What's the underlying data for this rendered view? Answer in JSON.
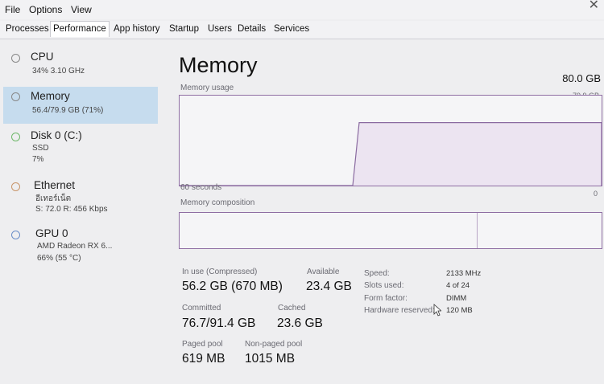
{
  "menu": [
    "File",
    "Options",
    "View"
  ],
  "tabs": [
    "Processes",
    "Performance",
    "App history",
    "Startup",
    "Users",
    "Details",
    "Services"
  ],
  "sidebar": [
    {
      "title": "CPU",
      "sub1": "34%  3.10 GHz",
      "sub2": "",
      "sub3": ""
    },
    {
      "title": "Memory",
      "sub1": "56.4/79.9 GB (71%)",
      "sub2": "",
      "sub3": ""
    },
    {
      "title": "Disk 0 (C:)",
      "sub1": "SSD",
      "sub2": "7%",
      "sub3": ""
    },
    {
      "title": "Ethernet",
      "sub1": "อีเทอร์เน็ต",
      "sub2": "S: 72.0  R: 456 Kbps",
      "sub3": ""
    },
    {
      "title": "GPU 0",
      "sub1": "AMD Radeon RX 6...",
      "sub2": "66% (55 °C)",
      "sub3": ""
    }
  ],
  "main": {
    "title": "Memory",
    "total": "80.0 GB",
    "usage_label": "Memory usage",
    "usage_max": "79.9 GB",
    "time_label": "60 seconds",
    "time_zero": "0",
    "composition_label": "Memory composition",
    "in_use_label": "In use (Compressed)",
    "in_use_value": "56.2 GB (670 MB)",
    "available_label": "Available",
    "available_value": "23.4 GB",
    "committed_label": "Committed",
    "committed_value": "76.7/91.4 GB",
    "cached_label": "Cached",
    "cached_value": "23.6 GB",
    "paged_label": "Paged pool",
    "paged_value": "619 MB",
    "nonpaged_label": "Non-paged pool",
    "nonpaged_value": "1015 MB",
    "specs": [
      {
        "label": "Speed:",
        "value": "2133 MHz"
      },
      {
        "label": "Slots used:",
        "value": "4 of 24"
      },
      {
        "label": "Form factor:",
        "value": "DIMM"
      },
      {
        "label": "Hardware reserved:",
        "value": "120 MB"
      }
    ]
  },
  "usage_level_fraction": 0.7,
  "colors": {
    "graph_border": "#8f6ea3",
    "selected_bg": "#c6dcee",
    "accent": "#8a6aa0"
  }
}
